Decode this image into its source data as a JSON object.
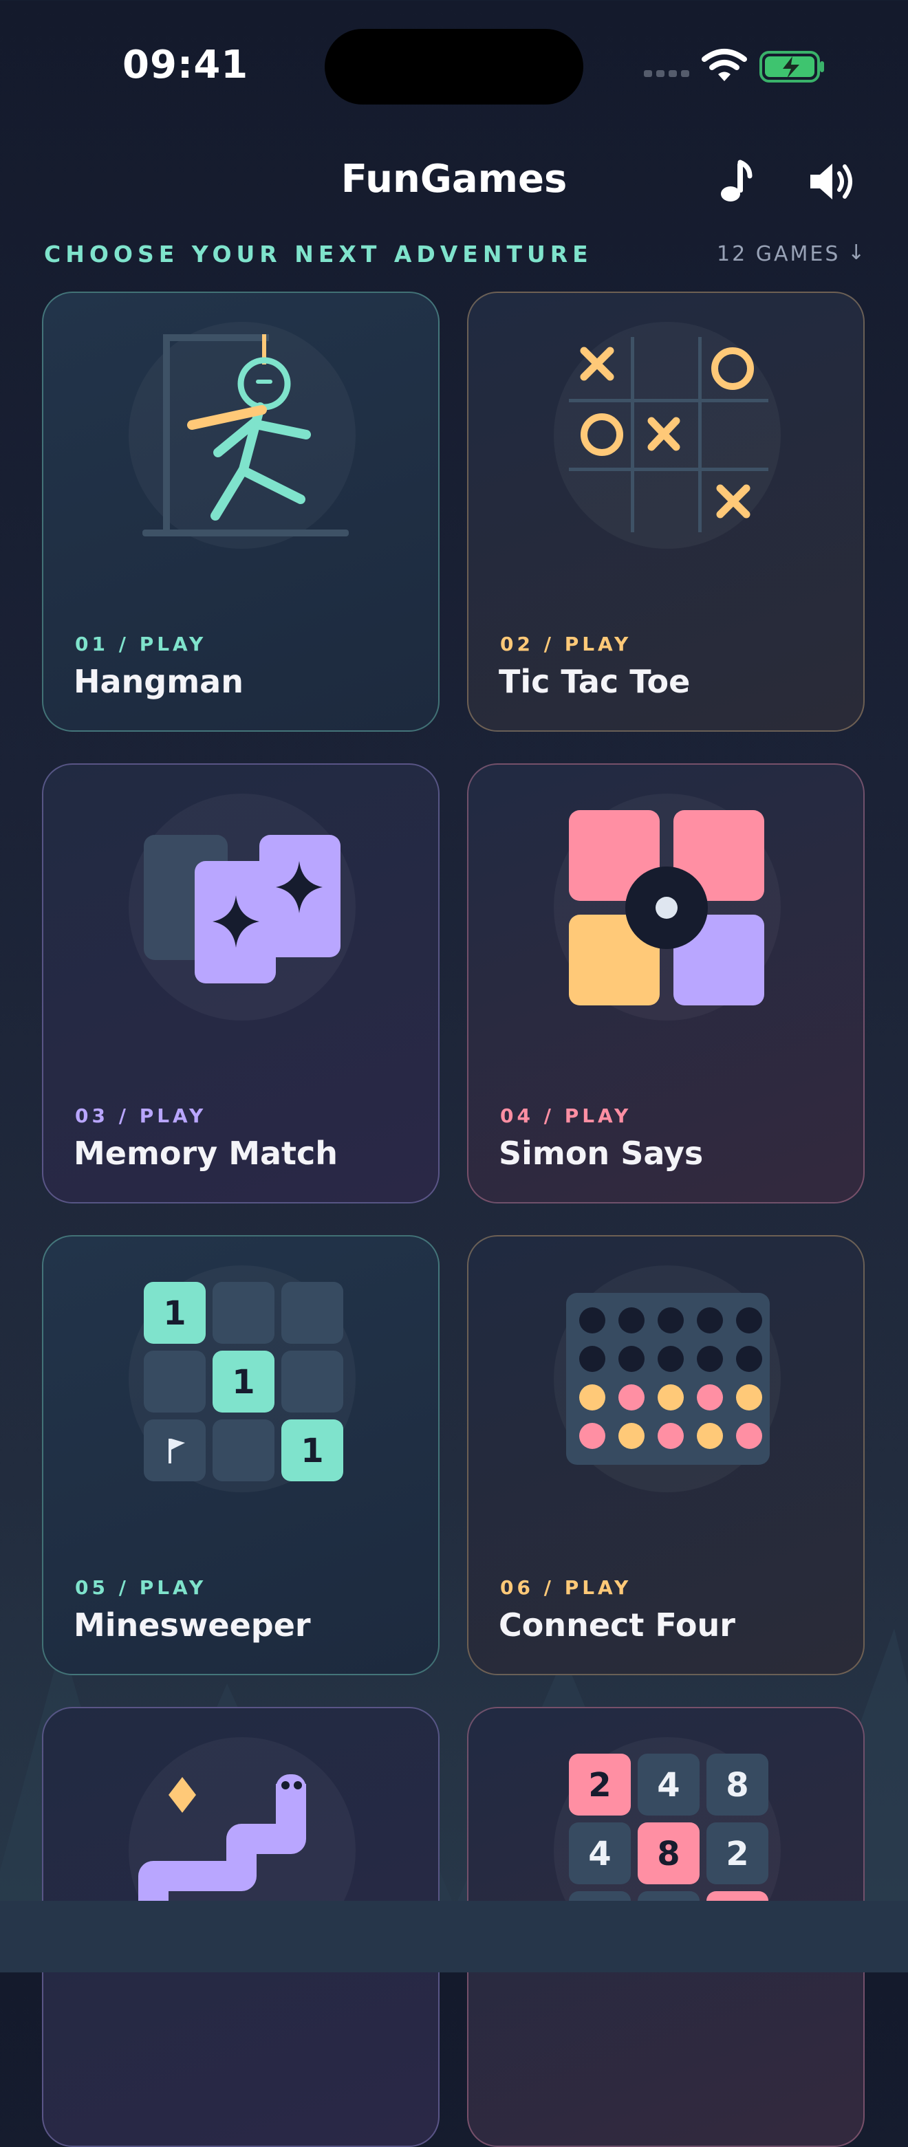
{
  "status_bar": {
    "time": "09:41"
  },
  "header": {
    "title": "FunGames"
  },
  "section": {
    "heading": "CHOOSE YOUR NEXT ADVENTURE",
    "count": "12 GAMES",
    "sort_arrow": "↓"
  },
  "games": [
    {
      "number": "01  /  PLAY",
      "name": "Hangman",
      "accent": "#7fe3cc"
    },
    {
      "number": "02  /  PLAY",
      "name": "Tic Tac Toe",
      "accent": "#ffc978"
    },
    {
      "number": "03  /  PLAY",
      "name": "Memory Match",
      "accent": "#b9a6ff"
    },
    {
      "number": "04  /  PLAY",
      "name": "Simon Says",
      "accent": "#ff8fa3"
    },
    {
      "number": "05  /  PLAY",
      "name": "Minesweeper",
      "accent": "#7fe3cc"
    },
    {
      "number": "06  /  PLAY",
      "name": "Connect Four",
      "accent": "#ffc978"
    }
  ],
  "tiles": {
    "minesweeper": [
      "1",
      "1",
      "1"
    ],
    "g2048": [
      "2",
      "4",
      "8",
      "4",
      "8",
      "2"
    ]
  },
  "icons": [
    "music-note-icon",
    "speaker-icon",
    "wifi-icon",
    "battery-icon",
    "cellular-icon",
    "arrow-down-icon"
  ],
  "colors": {
    "teal": "#7fe3cc",
    "gold": "#ffc978",
    "purple": "#b9a6ff",
    "pink": "#ff8fa3",
    "slate": "#374b61"
  }
}
